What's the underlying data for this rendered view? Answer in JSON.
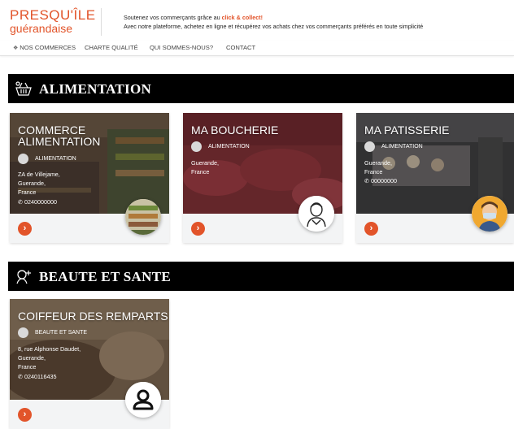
{
  "brand": {
    "line1": "PRESQU'ÎLE",
    "line2": "guérandaise"
  },
  "tagline": {
    "line1_prefix": "Soutenez vos commerçants grâce au ",
    "line1_highlight": "click & collect!",
    "line2": "Avec notre plateforme, achetez en ligne et récupérez vos achats chez vos commerçants préférés en toute simplicité"
  },
  "nav": {
    "home_icon": "house-icon",
    "items": [
      "NOS COMMERCES",
      "CHARTE QUALITÉ",
      "QUI SOMMES-NOUS?",
      "CONTACT"
    ]
  },
  "colors": {
    "accent": "#e2542a",
    "section_bg": "#000000",
    "card_bg": "#f3f4f5"
  },
  "sections": [
    {
      "title": "ALIMENTATION",
      "icon": "grocery-basket-icon",
      "cards": [
        {
          "title": "COMMERCE ALIMENTATION",
          "category": "ALIMENTATION",
          "address": [
            "ZA de Villejame,",
            "Guerande,",
            "France"
          ],
          "phone": "0240000000",
          "avatar": "shop-shelves-photo",
          "action_icon": "chevron-right-icon"
        },
        {
          "title": "MA BOUCHERIE",
          "category": "ALIMENTATION",
          "address": [
            "Guerande,",
            "France"
          ],
          "phone": "",
          "avatar": "person-outline-icon",
          "action_icon": "chevron-right-icon"
        },
        {
          "title": "MA PATISSERIE",
          "category": "ALIMENTATION",
          "address": [
            "Guerande,",
            "France"
          ],
          "phone": "00000000",
          "avatar": "baker-avatar",
          "action_icon": "chevron-right-icon"
        }
      ]
    },
    {
      "title": "BEAUTE ET SANTE",
      "icon": "beauty-spa-icon",
      "cards": [
        {
          "title": "COIFFEUR DES REMPARTS",
          "category": "BEAUTE ET SANTE",
          "address": [
            "8, rue Alphonse Daudet,",
            "Guerande,",
            "France"
          ],
          "phone": "0240116435",
          "avatar": "user-icon",
          "action_icon": "chevron-right-icon"
        }
      ]
    }
  ]
}
